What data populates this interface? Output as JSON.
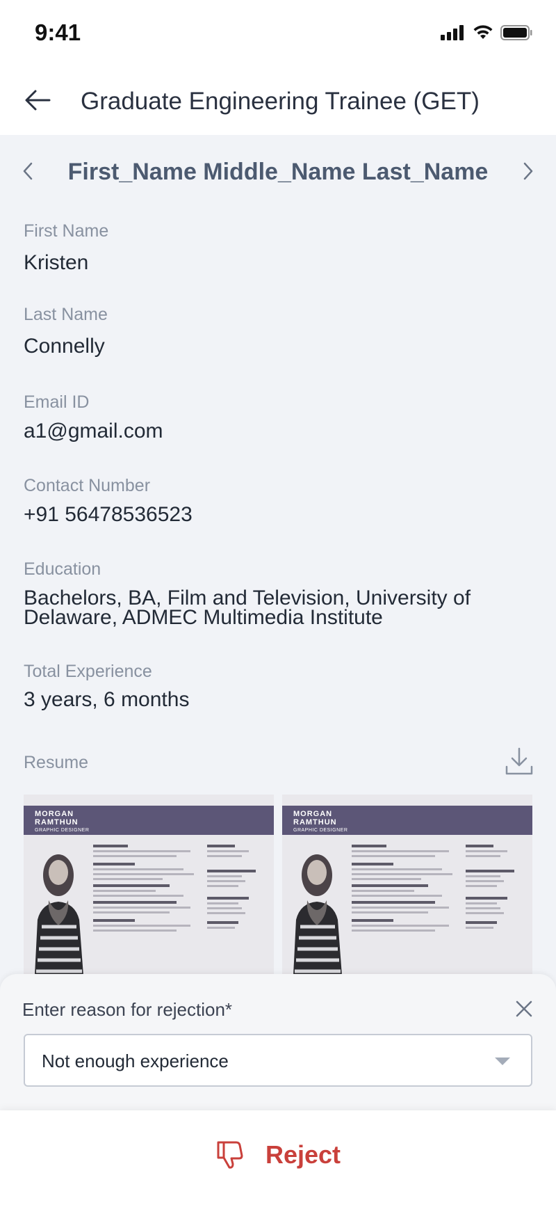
{
  "status_bar": {
    "time": "9:41"
  },
  "header": {
    "title": "Graduate Engineering Trainee (GET)"
  },
  "candidate": {
    "name": "First_Name Middle_Name Last_Name"
  },
  "fields": [
    {
      "label": "First Name",
      "value": "Kristen"
    },
    {
      "label": "Last Name",
      "value": "Connelly"
    },
    {
      "label": "Email ID",
      "value": "a1@gmail.com"
    },
    {
      "label": "Contact Number",
      "value": "+91 56478536523"
    },
    {
      "label": "Education",
      "value": "Bachelors, BA, Film and Television, University of Delaware, ADMEC Multimedia Institute"
    },
    {
      "label": "Total Experience",
      "value": "3 years, 6 months"
    }
  ],
  "resume": {
    "label": "Resume",
    "thumb_name_line1": "MORGAN",
    "thumb_name_line2": "RAMTHUN",
    "thumb_role": "GRAPHIC DESIGNER"
  },
  "rejection": {
    "title": "Enter reason for rejection*",
    "selected_reason": "Not enough experience"
  },
  "actions": {
    "reject_label": "Reject"
  },
  "colors": {
    "accent_reject": "#c9403b",
    "name_color": "#4c5a70",
    "resume_band": "#5c5677"
  }
}
